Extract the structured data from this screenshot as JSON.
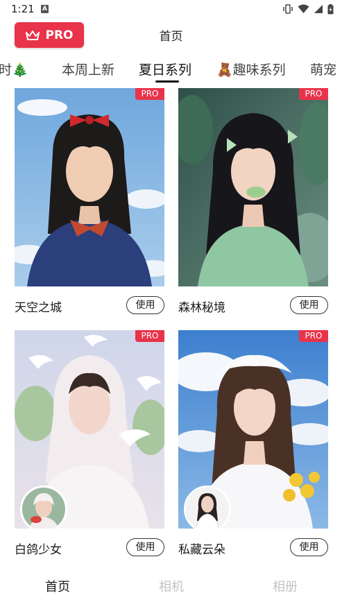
{
  "status_bar": {
    "time": "1:21",
    "notification_letter": "A"
  },
  "header": {
    "pro_label": "PRO",
    "title": "首页"
  },
  "tabs": [
    {
      "label": "时🎄"
    },
    {
      "label": "本周上新"
    },
    {
      "label": "夏日系列"
    },
    {
      "label": "🧸趣味系列"
    },
    {
      "label": "萌宠"
    }
  ],
  "cards": [
    {
      "title": "天空之城",
      "badge": "PRO",
      "button": "使用"
    },
    {
      "title": "森林秘境",
      "badge": "PRO",
      "button": "使用"
    },
    {
      "title": "白鸽少女",
      "badge": "PRO",
      "button": "使用"
    },
    {
      "title": "私藏云朵",
      "badge": "PRO",
      "button": "使用"
    }
  ],
  "bottom_nav": [
    {
      "label": "首页"
    },
    {
      "label": "相机"
    },
    {
      "label": "相册"
    }
  ],
  "colors": {
    "accent": "#e8334a",
    "text": "#1a1a1a",
    "inactive": "#c4c4c4"
  }
}
